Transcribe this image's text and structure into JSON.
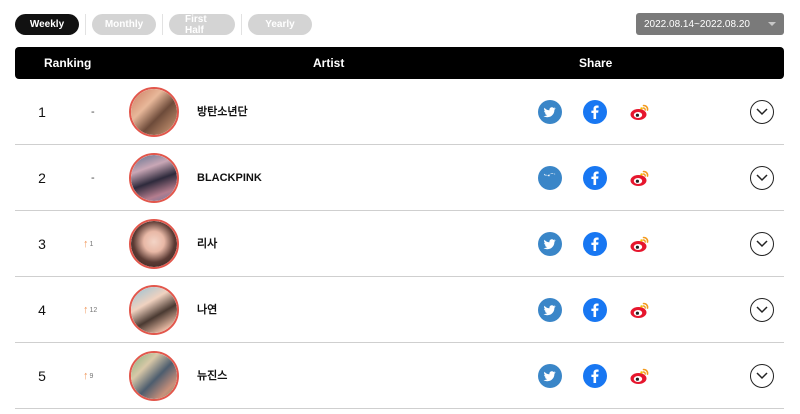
{
  "tabs": [
    {
      "label": "Weekly",
      "active": true
    },
    {
      "label": "Monthly",
      "active": false
    },
    {
      "label": "First Half",
      "active": false
    },
    {
      "label": "Yearly",
      "active": false
    }
  ],
  "date_range": {
    "selected": "2022.08.14~2022.08.20"
  },
  "table": {
    "headers": {
      "ranking": "Ranking",
      "artist": "Artist",
      "share": "Share"
    },
    "rows": [
      {
        "rank": "1",
        "change": "-",
        "change_type": "same",
        "change_value": "",
        "name": "방탄소년단"
      },
      {
        "rank": "2",
        "change": "-",
        "change_type": "same",
        "change_value": "",
        "name": "BLACKPINK"
      },
      {
        "rank": "3",
        "change": "",
        "change_type": "up",
        "change_value": "1",
        "name": "리사"
      },
      {
        "rank": "4",
        "change": "",
        "change_type": "up",
        "change_value": "12",
        "name": "나연"
      },
      {
        "rank": "5",
        "change": "",
        "change_type": "up",
        "change_value": "9",
        "name": "뉴진스"
      }
    ]
  },
  "icons": {
    "share": [
      "twitter-icon",
      "facebook-icon",
      "weibo-icon"
    ],
    "expand": "chevron-down-icon"
  },
  "colors": {
    "twitter": "#3a86c8",
    "facebook": "#1877f2",
    "weibo": "#e6162d",
    "rank_up": "#f0965a",
    "avatar_ring": "#e2574c"
  }
}
